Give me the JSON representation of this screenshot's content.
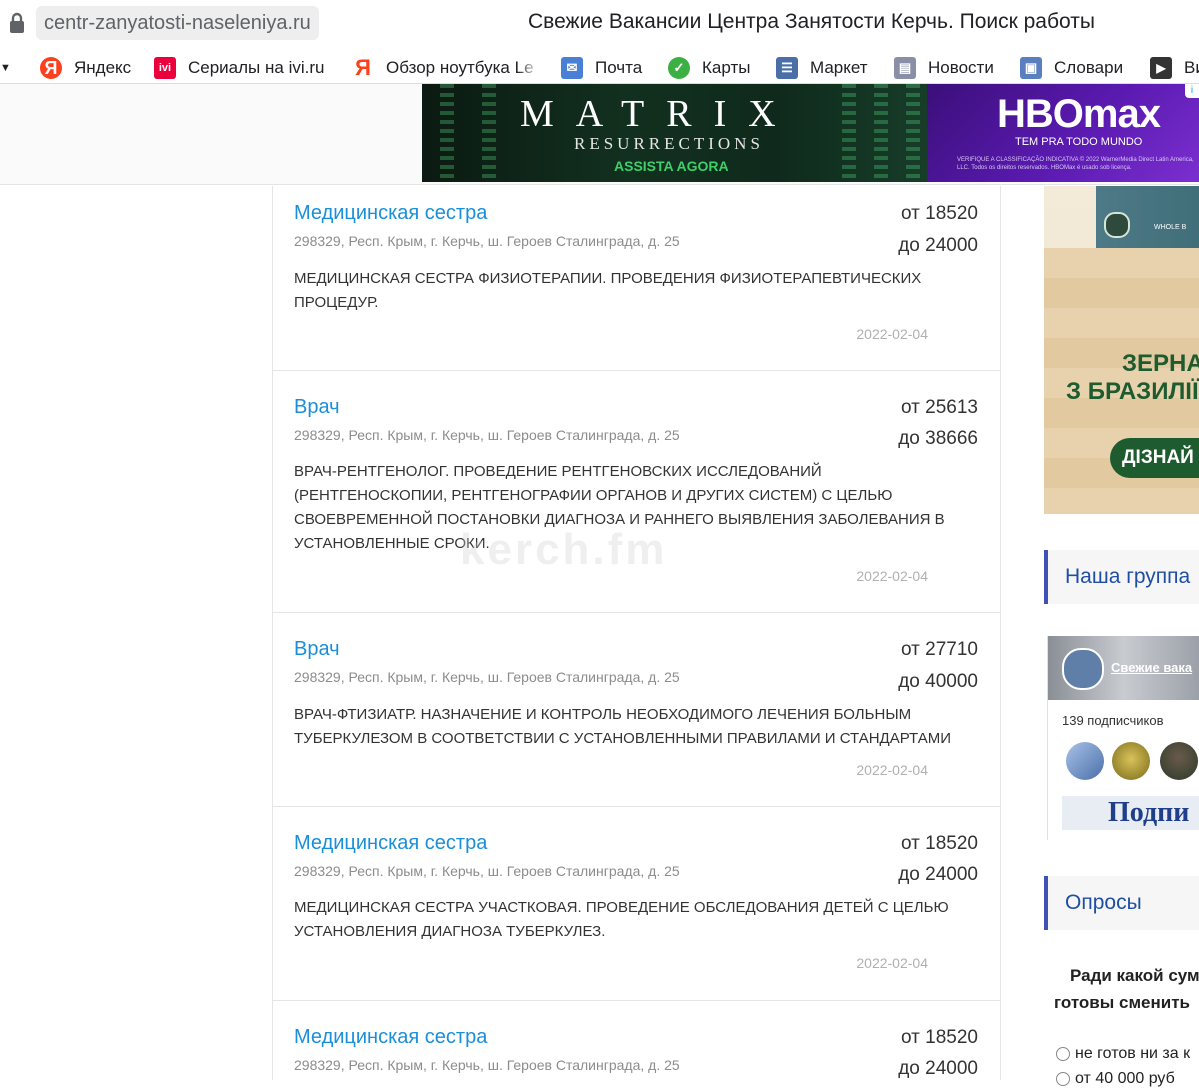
{
  "browser": {
    "url": "centr-zanyatosti-naseleniya.ru",
    "title": "Свежие Вакансии Центра Занятости Керчь. Поиск работы",
    "bookmarks": [
      {
        "label": "Яндекс",
        "icon": "yandex-icon"
      },
      {
        "label": "Сериалы на ivi.ru",
        "icon": "ivi-icon"
      },
      {
        "label": "Обзор ноутбука Le",
        "icon": "yandex-icon"
      },
      {
        "label": "Почта",
        "icon": "mail-icon"
      },
      {
        "label": "Карты",
        "icon": "maps-icon"
      },
      {
        "label": "Маркет",
        "icon": "market-icon"
      },
      {
        "label": "Новости",
        "icon": "news-icon"
      },
      {
        "label": "Словари",
        "icon": "dictionary-icon"
      },
      {
        "label": "Ви",
        "icon": "video-icon"
      }
    ]
  },
  "ads": {
    "matrix_title": "MATRIX",
    "matrix_sub": "RESURRECTIONS",
    "matrix_cta": "ASSISTA AGORA",
    "hbo_logo": "HBOmax",
    "hbo_tag": "TEM PRA TODO MUNDO",
    "hbo_fine": "VERIFIQUE A CLASSIFICAÇÃO INDICATIVA © 2022 WarnerMedia Direct Latin America, LLC. Todos os direitos reservados. HBOMax é usado sob licença.",
    "coffee_brand": "WHOLE B",
    "coffee_line1": "ЗЕРНА",
    "coffee_line2": "З БРАЗИЛІЇ",
    "coffee_button": "ДІЗНАЙ"
  },
  "jobs": [
    {
      "title": "Медицинская сестра",
      "address": "298329, Респ. Крым, г. Керчь, ш. Героев Сталинграда, д. 25",
      "salary_from": "от 18520",
      "salary_to": "до 24000",
      "description": "МЕДИЦИНСКАЯ СЕСТРА ФИЗИОТЕРАПИИ. ПРОВЕДЕНИЯ ФИЗИОТЕРАПЕВТИЧЕСКИХ ПРОЦЕДУР.",
      "date": "2022-02-04"
    },
    {
      "title": "Врач",
      "address": "298329, Респ. Крым, г. Керчь, ш. Героев Сталинграда, д. 25",
      "salary_from": "от 25613",
      "salary_to": "до 38666",
      "description": "ВРАЧ-РЕНТГЕНОЛОГ. ПРОВЕДЕНИЕ РЕНТГЕНОВСКИХ ИССЛЕДОВАНИЙ (РЕНТГЕНОСКОПИИ, РЕНТГЕНОГРАФИИ ОРГАНОВ И ДРУГИХ СИСТЕМ) С ЦЕЛЬЮ СВОЕВРЕМЕННОЙ ПОСТАНОВКИ ДИАГНОЗА И РАННЕГО ВЫЯВЛЕНИЯ ЗАБОЛЕВАНИЯ В УСТАНОВЛЕННЫЕ СРОКИ.",
      "date": "2022-02-04"
    },
    {
      "title": "Врач",
      "address": "298329, Респ. Крым, г. Керчь, ш. Героев Сталинграда, д. 25",
      "salary_from": "от 27710",
      "salary_to": "до 40000",
      "description": "ВРАЧ-ФТИЗИАТР. НАЗНАЧЕНИЕ И КОНТРОЛЬ НЕОБХОДИМОГО ЛЕЧЕНИЯ БОЛЬНЫМ ТУБЕРКУЛЕЗОМ В СООТВЕТСТВИИ С УСТАНОВЛЕННЫМИ ПРАВИЛАМИ И СТАНДАРТАМИ",
      "date": "2022-02-04"
    },
    {
      "title": "Медицинская сестра",
      "address": "298329, Респ. Крым, г. Керчь, ш. Героев Сталинграда, д. 25",
      "salary_from": "от 18520",
      "salary_to": "до 24000",
      "description": "МЕДИЦИНСКАЯ СЕСТРА УЧАСТКОВАЯ. ПРОВЕДЕНИЕ ОБСЛЕДОВАНИЯ ДЕТЕЙ С ЦЕЛЬЮ УСТАНОВЛЕНИЯ ДИАГНОЗА ТУБЕРКУЛЕЗ.",
      "date": "2022-02-04"
    },
    {
      "title": "Медицинская сестра",
      "address": "298329, Респ. Крым, г. Керчь, ш. Героев Сталинграда, д. 25",
      "salary_from": "от 18520",
      "salary_to": "до 24000",
      "description": "",
      "date": ""
    }
  ],
  "watermark": "kerch.fm",
  "sidebar": {
    "group_heading": "Наша группа",
    "vk_name": "Свежие вака",
    "vk_subscribers": "139 подписчиков",
    "vk_subscribe": "Подпи",
    "polls_heading": "Опросы",
    "poll_question_1": "Ради какой сум",
    "poll_question_2": "готовы сменить",
    "poll_option_1": "не готов ни за к",
    "poll_option_2": "от 40 000 руб"
  }
}
